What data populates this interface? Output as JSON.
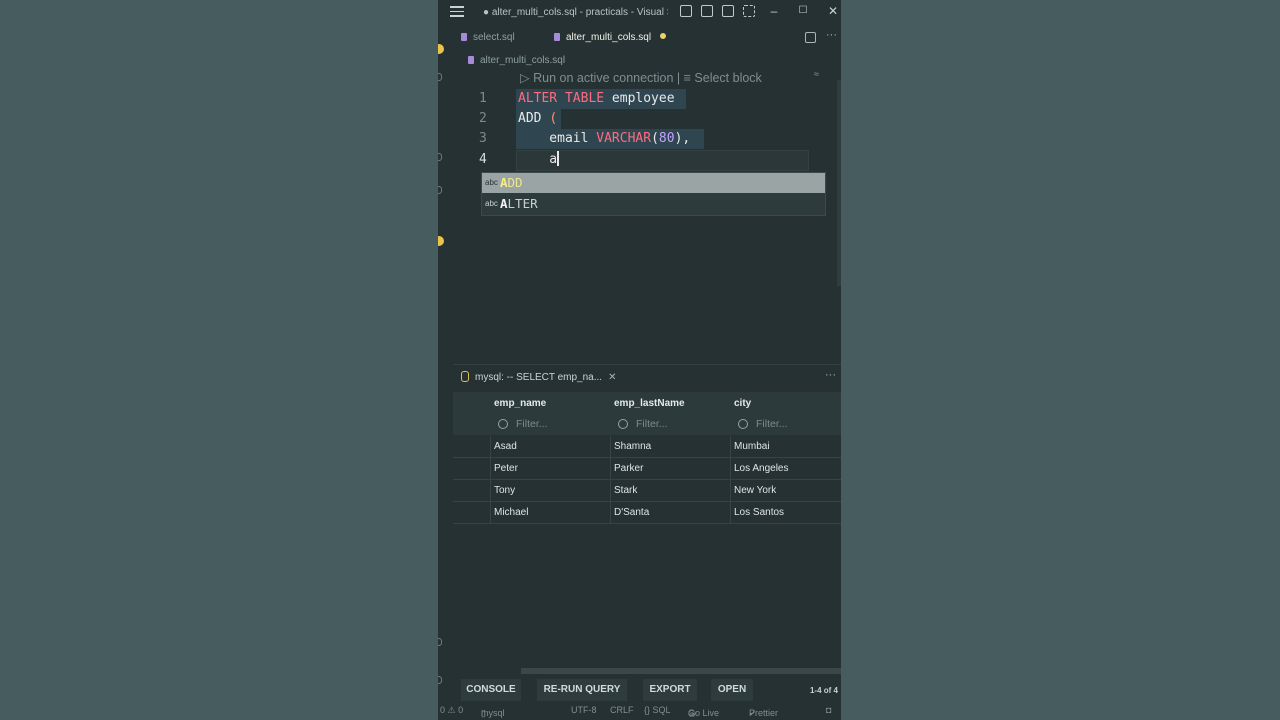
{
  "window": {
    "title": "● alter_multi_cols.sql - practicals - Visual S...",
    "controls": {
      "minimize": "–",
      "maximize": "☐",
      "close": "✕"
    }
  },
  "tabs": [
    {
      "label": "select.sql",
      "active": false
    },
    {
      "label": "alter_multi_cols.sql",
      "active": true,
      "dirty": true
    }
  ],
  "breadcrumb": "alter_multi_cols.sql",
  "codelens": "▷ Run on active connection | ≡ Select block",
  "editor": {
    "lines": [
      {
        "num": "1",
        "tokens": [
          {
            "t": "ALTER TABLE ",
            "c": "kw"
          },
          {
            "t": "employee",
            "c": "pl"
          }
        ]
      },
      {
        "num": "2",
        "tokens": [
          {
            "t": "ADD ",
            "c": "pl"
          },
          {
            "t": "(",
            "c": "par"
          }
        ]
      },
      {
        "num": "3",
        "tokens": [
          {
            "t": "    email ",
            "c": "pl"
          },
          {
            "t": "VARCHAR",
            "c": "fn"
          },
          {
            "t": "(",
            "c": "pl"
          },
          {
            "t": "80",
            "c": "num"
          },
          {
            "t": "),",
            "c": "pl"
          }
        ]
      },
      {
        "num": "4",
        "tokens": [
          {
            "t": "    a",
            "c": "pl"
          }
        ]
      }
    ]
  },
  "suggestions": [
    {
      "kind": "abc",
      "match": "A",
      "rest": "DD",
      "selected": true
    },
    {
      "kind": "abc",
      "match": "A",
      "rest": "LTER",
      "selected": false
    }
  ],
  "panel": {
    "title": "mysql: -- SELECT emp_na...",
    "close": "✕",
    "more": "···",
    "columns": [
      "emp_name",
      "emp_lastName",
      "city"
    ],
    "filter_placeholder": "Filter...",
    "rows": [
      [
        "Asad",
        "Shamna",
        "Mumbai"
      ],
      [
        "Peter",
        "Parker",
        "Los Angeles"
      ],
      [
        "Tony",
        "Stark",
        "New York"
      ],
      [
        "Michael",
        "D'Santa",
        "Los Santos"
      ]
    ],
    "actions": [
      "CONSOLE",
      "RE-RUN QUERY",
      "EXPORT",
      "OPEN"
    ],
    "row_count": "1-4 of 4"
  },
  "statusbar": {
    "problems": "0 ⚠ 0",
    "connection": "mysql",
    "encoding": "UTF-8",
    "eol": "CRLF",
    "language": "{} SQL",
    "golive": "Go Live",
    "prettier": "Prettier"
  },
  "colors": {
    "background": "#465c5e",
    "editor": "#263133",
    "keyword": "#ff6b7f",
    "number": "#c3a2ff",
    "accent": "#e9c54a"
  }
}
